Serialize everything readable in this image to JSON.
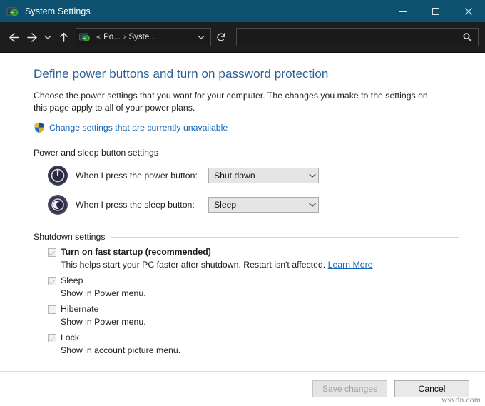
{
  "window": {
    "title": "System Settings",
    "icon": "system-settings-icon",
    "titlebar_color": "#0d5070",
    "controls": {
      "minimize": "minimize-icon",
      "maximize": "maximize-icon",
      "close": "close-icon"
    }
  },
  "navbar": {
    "back": "back-arrow-icon",
    "forward": "forward-arrow-icon",
    "recent": "chevron-down-icon",
    "up": "up-arrow-icon",
    "refresh": "refresh-icon",
    "address": {
      "icon": "system-settings-icon",
      "overflow": "«",
      "crumbs": [
        "Po...",
        "Syste..."
      ],
      "separator": "›",
      "dropdown": "chevron-down-icon"
    },
    "search": {
      "value": "",
      "placeholder": "",
      "icon": "search-icon"
    }
  },
  "page": {
    "title": "Define power buttons and turn on password protection",
    "description": "Choose the power settings that you want for your computer. The changes you make to the settings on this page apply to all of your power plans.",
    "uac_link": "Change settings that are currently unavailable",
    "uac_icon": "shield-icon",
    "link_color": "#1166bb",
    "title_color": "#2e5e95"
  },
  "power_sleep_section": {
    "title": "Power and sleep button settings",
    "rows": [
      {
        "icon": "power-button-icon",
        "label": "When I press the power button:",
        "value": "Shut down",
        "arrow": "chevron-down-icon"
      },
      {
        "icon": "sleep-button-icon",
        "label": "When I press the sleep button:",
        "value": "Sleep",
        "arrow": "chevron-down-icon"
      }
    ]
  },
  "shutdown_section": {
    "title": "Shutdown settings",
    "items": [
      {
        "label": "Turn on fast startup (recommended)",
        "checked": true,
        "bold": true,
        "sub_text": "This helps start your PC faster after shutdown. Restart isn't affected.",
        "sub_link": "Learn More"
      },
      {
        "label": "Sleep",
        "checked": true,
        "bold": false,
        "sub_text": "Show in Power menu.",
        "sub_link": ""
      },
      {
        "label": "Hibernate",
        "checked": false,
        "bold": false,
        "sub_text": "Show in Power menu.",
        "sub_link": ""
      },
      {
        "label": "Lock",
        "checked": true,
        "bold": false,
        "sub_text": "Show in account picture menu.",
        "sub_link": ""
      }
    ]
  },
  "footer": {
    "save_label": "Save changes",
    "save_disabled": true,
    "cancel_label": "Cancel",
    "watermark": "wsxdn.com"
  }
}
